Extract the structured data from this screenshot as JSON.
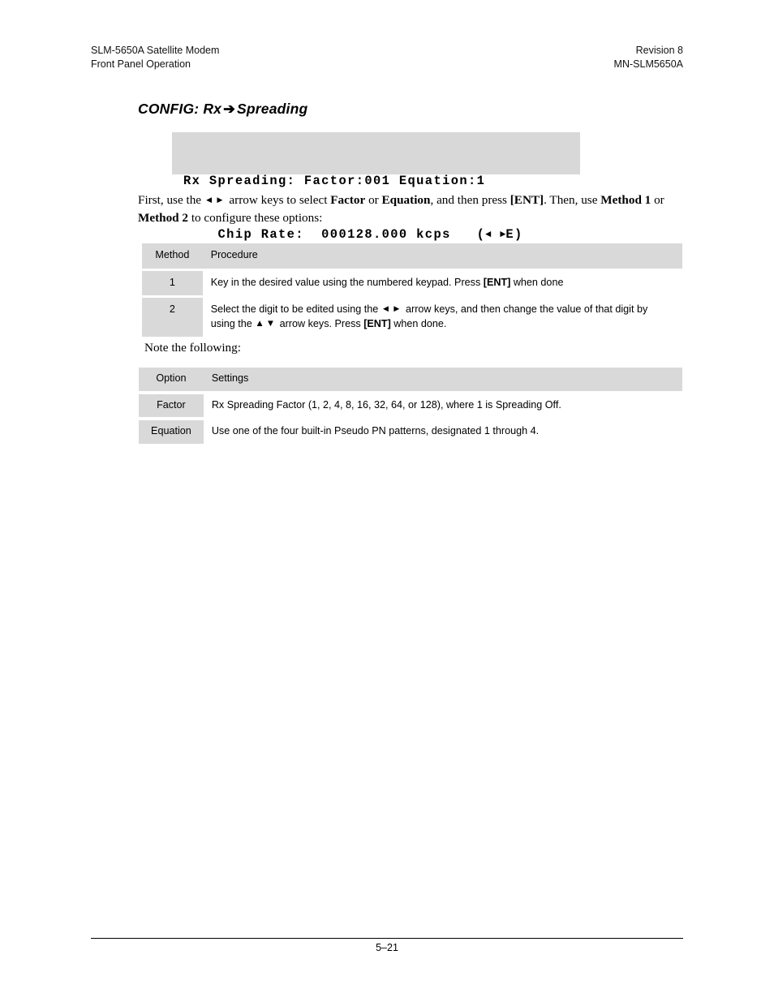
{
  "header": {
    "left_line1": "SLM-5650A Satellite Modem",
    "left_line2": "Front Panel Operation",
    "right_line1": "Revision 8",
    "right_line2": "MN-SLM5650A"
  },
  "section": {
    "title_prefix": "CONFIG: Rx",
    "title_arrow": "➔",
    "title_suffix": "Spreading"
  },
  "lcd": {
    "line1": "Rx Spreading: Factor:001 Equation:1",
    "line2_text": "    Chip Rate:  000128.000 kcps   (",
    "line2_left_arrow": "◄",
    "line2_spacer": " ",
    "line2_right_arrow": "►",
    "line2_tail": "E)"
  },
  "intro": {
    "part1": "First, use the ",
    "left_arrow": "◄",
    "right_arrow": "►",
    "part2": " arrow keys to select ",
    "bold_factor": "Factor",
    "part3": " or ",
    "bold_equation": "Equation",
    "part4": ", and then press ",
    "bold_ent": "[ENT]",
    "part5": ". Then, use ",
    "bold_method1": "Method 1",
    "part6": " or ",
    "bold_method2": "Method 2",
    "part7": " to configure these options:"
  },
  "note_line": "Note the following:",
  "table_method": {
    "headers": [
      "Method",
      "Procedure"
    ],
    "rows": [
      {
        "key": "1",
        "body_part1": "Key in the desired value using the numbered keypad. Press ",
        "body_bold": "[ENT]",
        "body_part2": " when done"
      },
      {
        "key": "2",
        "body_part1": "Select the digit to be edited using the ",
        "left_arrow": "◄",
        "right_arrow": "►",
        "body_part2": " arrow keys, and then change the value of that digit by using the ",
        "up_arrow": "▲",
        "down_arrow": "▼",
        "body_part3": " arrow keys. Press ",
        "body_bold": "[ENT]",
        "body_part4": " when done."
      }
    ]
  },
  "table_option": {
    "headers": [
      "Option",
      "Settings"
    ],
    "rows": [
      {
        "key": "Factor",
        "body": "Rx Spreading Factor (1, 2, 4, 8, 16, 32, 64, or 128), where 1 is Spreading Off."
      },
      {
        "key": "Equation",
        "body": "Use one of the four built-in Pseudo PN patterns, designated 1 through 4."
      }
    ]
  },
  "footer": {
    "page_number": "5–21"
  },
  "colors": {
    "table_fill": "#d9d9d9",
    "lcd_fill": "#d8d8d8",
    "text": "#000000"
  }
}
